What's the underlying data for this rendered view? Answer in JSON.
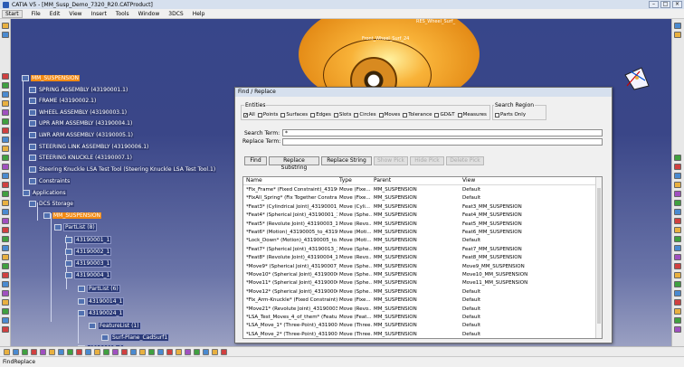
{
  "window": {
    "title": "CATIA V5 - [MM_Susp_Demo_7320_R20.CATProduct]"
  },
  "menu": [
    "Start",
    "File",
    "Edit",
    "View",
    "Insert",
    "Tools",
    "Window",
    "3DCS",
    "Help"
  ],
  "viewport_labels": {
    "label1": "Front_Wheel_Surf_24",
    "label2": "RES_Wheel_Surf_"
  },
  "tree": [
    {
      "label": "MM_SUSPENSION"
    },
    {
      "label": "SPRING ASSEMBLY (43190001.1)"
    },
    {
      "label": "FRAME (43190002.1)"
    },
    {
      "label": "WHEEL ASSEMBLY (43190003.1)"
    },
    {
      "label": "UPR ARM ASSEMBLY (43190004.1)"
    },
    {
      "label": "LWR ARM ASSEMBLY (43190005.1)"
    },
    {
      "label": "STEERING LINK ASSEMBLY (43190006.1)"
    },
    {
      "label": "STEERING KNUCKLE (43190007.1)"
    },
    {
      "label": "Steering Knuckle LSA Test Tool (Steering Knuckle LSA Test Tool.1)"
    },
    {
      "label": "Constraints"
    },
    {
      "label": "Applications"
    },
    {
      "label": "DCS Storage"
    },
    {
      "label": "MM_SUSPENSION"
    },
    {
      "label": "PartList (8)"
    },
    {
      "label": "43190001_1"
    },
    {
      "label": "43190002_1"
    },
    {
      "label": "43190003_1"
    },
    {
      "label": "43190004_1"
    },
    {
      "label": "PartList (6)"
    },
    {
      "label": "43190014_1"
    },
    {
      "label": "43190024_1"
    },
    {
      "label": "FeatureList (1)"
    },
    {
      "label": "Surf-Plane_CadSurf1"
    },
    {
      "label": "43190017_1"
    }
  ],
  "dialog": {
    "title": "Find / Replace",
    "entities_label": "Entities",
    "entities": [
      {
        "label": "All",
        "checked": true
      },
      {
        "label": "Points",
        "checked": false
      },
      {
        "label": "Surfaces",
        "checked": false
      },
      {
        "label": "Edges",
        "checked": false
      },
      {
        "label": "Slots",
        "checked": false
      },
      {
        "label": "Circles",
        "checked": false
      },
      {
        "label": "Moves",
        "checked": false
      },
      {
        "label": "Tolerance",
        "checked": false
      },
      {
        "label": "GD&T",
        "checked": false
      },
      {
        "label": "Measures",
        "checked": false
      }
    ],
    "search_region_label": "Search Region",
    "parts_only": "Parts Only",
    "search_term_label": "Search Term:",
    "search_term_value": "*",
    "replace_term_label": "Replace Term:",
    "replace_term_value": "",
    "buttons": {
      "find": "Find",
      "replace_substring": "Replace Substring",
      "replace_string": "Replace String",
      "d1": "Show Pick",
      "d2": "Hide Pick",
      "d3": "Delete Pick"
    },
    "columns": [
      "Name",
      "Type",
      "Parent",
      "View"
    ],
    "rows": [
      [
        "*Fix_Frame* (Fixed Constraint)_43190002_1",
        "Move (Fixe...",
        "MM_SUSPENSION",
        "Default"
      ],
      [
        "*FixAll_Spring* (Fix Together Constrai...",
        "Move (Fixe...",
        "MM_SUSPENSION",
        "Default"
      ],
      [
        "*Feat3* (Cylindrical Joint)_43190001_...",
        "Move (Cyli...",
        "MM_SUSPENSION",
        "Feat3_MM_SUSPENSION"
      ],
      [
        "*Feat4* (Spherical Joint)_43190001_1...",
        "Move (Sphe...",
        "MM_SUSPENSION",
        "Feat4_MM_SUSPENSION"
      ],
      [
        "*Feat5* (Revolute Joint)_43190003_1_4...",
        "Move (Revo...",
        "MM_SUSPENSION",
        "Feat5_MM_SUSPENSION"
      ],
      [
        "*Feat6* (Motion)_43190005_to_43190...",
        "Move (Moti...",
        "MM_SUSPENSION",
        "Feat6_MM_SUSPENSION"
      ],
      [
        "*Lock_Down* (Motion)_43190005_to...",
        "Move (Moti...",
        "MM_SUSPENSION",
        "Default"
      ],
      [
        "*Feat7* (Spherical Joint)_43190013_1...",
        "Move (Sphe...",
        "MM_SUSPENSION",
        "Feat7_MM_SUSPENSION"
      ],
      [
        "*Feat8* (Revolute Joint)_43190004_1_4...",
        "Move (Revo...",
        "MM_SUSPENSION",
        "Feat8_MM_SUSPENSION"
      ],
      [
        "*Move9* (Spherical Joint)_43190007_...",
        "Move (Sphe...",
        "MM_SUSPENSION",
        "Move9_MM_SUSPENSION"
      ],
      [
        "*Move10* (Spherical Joint)_43190006_...",
        "Move (Sphe...",
        "MM_SUSPENSION",
        "Move10_MM_SUSPENSION"
      ],
      [
        "*Move11* (Spherical Joint)_43190006_...",
        "Move (Sphe...",
        "MM_SUSPENSION",
        "Move11_MM_SUSPENSION"
      ],
      [
        "*Move12* (Spherical Joint)_43190006_...",
        "Move (Sphe...",
        "MM_SUSPENSION",
        "Default"
      ],
      [
        "*Fix_Arm-Knuckle* (Fixed Constraint)...",
        "Move (Fixe...",
        "MM_SUSPENSION",
        "Default"
      ],
      [
        "*Move21* (Revolute Joint)_43190003_4...",
        "Move (Revo...",
        "MM_SUSPENSION",
        "Default"
      ],
      [
        "*LSA_Test_Moves_4_of_them* (Featur...",
        "Move (Feat...",
        "MM_SUSPENSION",
        "Default"
      ],
      [
        "*LSA_Move_1* (Three-Point)_4319001...",
        "Move (Three...",
        "MM_SUSPENSION",
        "Default"
      ],
      [
        "*LSA_Move_2* (Three-Point)_4319001...",
        "Move (Three...",
        "MM_SUSPENSION",
        "Default"
      ]
    ]
  },
  "status": {
    "text": "FindReplace"
  }
}
